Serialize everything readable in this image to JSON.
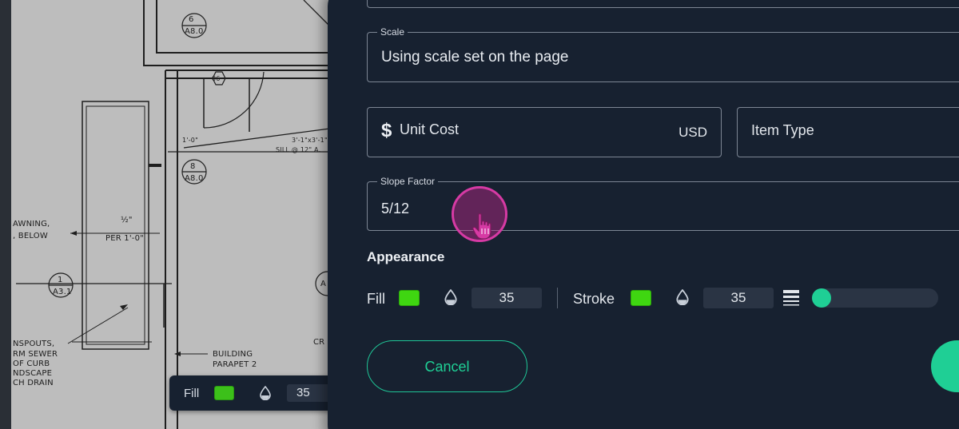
{
  "blueprint": {
    "annotations": [
      "6",
      "A8.0",
      "06",
      "1'-0\"",
      "3'-1\"x3'-1\"",
      "SILL @ 12\" A.",
      "8",
      "A8.0",
      "AWNING,",
      ", BELOW",
      "½\"",
      "PER 1'-0\"",
      "1",
      "A3.1",
      "A",
      "NSPOUTS,",
      "RM SEWER",
      "OF CURB",
      "NDSCAPE",
      "CH DRAIN",
      "BUILDING",
      "PARAPET 2",
      "CR"
    ]
  },
  "mini_toolbar": {
    "fill_label": "Fill",
    "fill_color": "#3cc01a",
    "opacity_icon": "drop-icon",
    "opacity_value": "35"
  },
  "form": {
    "scale": {
      "label": "Scale",
      "value": "Using scale set on the page"
    },
    "unit_cost": {
      "icon": "dollar-icon",
      "placeholder": "Unit Cost",
      "currency": "USD"
    },
    "item_type": {
      "placeholder": "Item Type"
    },
    "slope_factor": {
      "label": "Slope Factor",
      "value": "5/12"
    }
  },
  "appearance": {
    "title": "Appearance",
    "fill": {
      "label": "Fill",
      "color": "#3fd611",
      "opacity": "35"
    },
    "stroke": {
      "label": "Stroke",
      "color": "#3fd611",
      "opacity": "35",
      "width_level": 0
    }
  },
  "actions": {
    "cancel_label": "Cancel"
  },
  "colors": {
    "panel_bg": "#172130",
    "accent": "#1fcf95",
    "cursor_highlight": "#d63aa4"
  }
}
